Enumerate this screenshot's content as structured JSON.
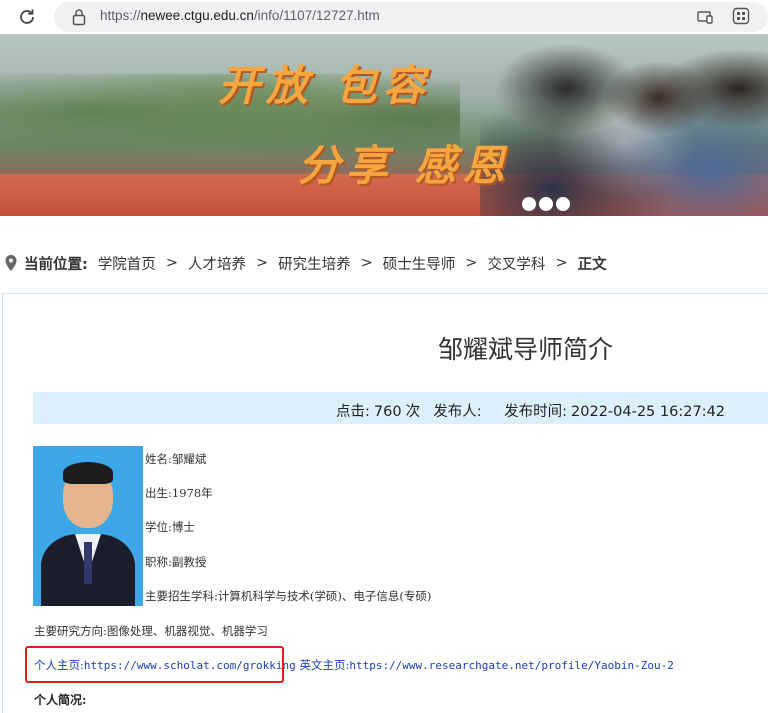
{
  "browser": {
    "url_prefix": "https://",
    "url_host": "newee.ctgu.edu.cn",
    "url_path": "/info/1107/12727.htm"
  },
  "banner": {
    "slogan_line1": "开放  包容",
    "slogan_line2": "分享  感恩",
    "slide_count": 3
  },
  "breadcrumb": {
    "label": "当前位置:",
    "items": [
      "学院首页",
      "人才培养",
      "研究生培养",
      "硕士生导师",
      "交叉学科"
    ],
    "separator": ">",
    "current": "正文"
  },
  "article": {
    "title": "邹耀斌导师简介",
    "clicks_label": "点击:",
    "clicks_value": "760",
    "clicks_unit": "次",
    "publisher_label": "发布人:",
    "time_label": "发布时间:",
    "time_value": "2022-04-25 16:27:42",
    "fields": {
      "name": "姓名:邹耀斌",
      "birth": "出生:1978年",
      "degree": "学位:博士",
      "title": "职称:副教授",
      "subjects": "主要招生学科:计算机科学与技术(学硕)、电子信息(专硕)"
    },
    "research": "主要研究方向:图像处理、机器视觉、机器学习",
    "homepage_label": "个人主页:",
    "homepage_url": "https://www.scholat.com/grokking",
    "en_homepage_label": "英文主页:",
    "en_homepage_url": "https://www.researchgate.net/profile/Yaobin-Zou-2",
    "bio_heading": "个人简况:"
  },
  "colors": {
    "info_bar": "#dcf0fb",
    "link": "#1a3dbd",
    "highlight_box": "#e01e1e",
    "slogan": "#f4a640"
  }
}
